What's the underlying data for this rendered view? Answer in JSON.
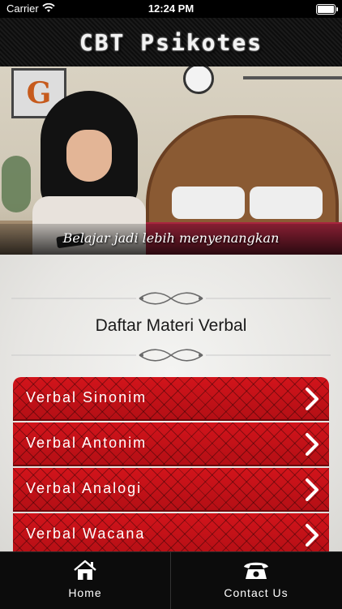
{
  "status_bar": {
    "carrier": "Carrier",
    "time": "12:24 PM"
  },
  "header": {
    "title": "CBT Psikotes"
  },
  "banner": {
    "caption": "Belajar jadi lebih menyenangkan",
    "frame_letter": "G"
  },
  "content": {
    "section_title": "Daftar Materi Verbal",
    "items": [
      {
        "label": "Verbal Sinonim"
      },
      {
        "label": "Verbal Antonim"
      },
      {
        "label": "Verbal Analogi"
      },
      {
        "label": "Verbal Wacana"
      }
    ]
  },
  "tabbar": {
    "tabs": [
      {
        "label": "Home",
        "icon": "home-icon"
      },
      {
        "label": "Contact Us",
        "icon": "phone-icon"
      }
    ]
  },
  "colors": {
    "menu_red": "#c8121a",
    "header_bg": "#141414",
    "tabbar_bg": "#0c0c0c"
  }
}
